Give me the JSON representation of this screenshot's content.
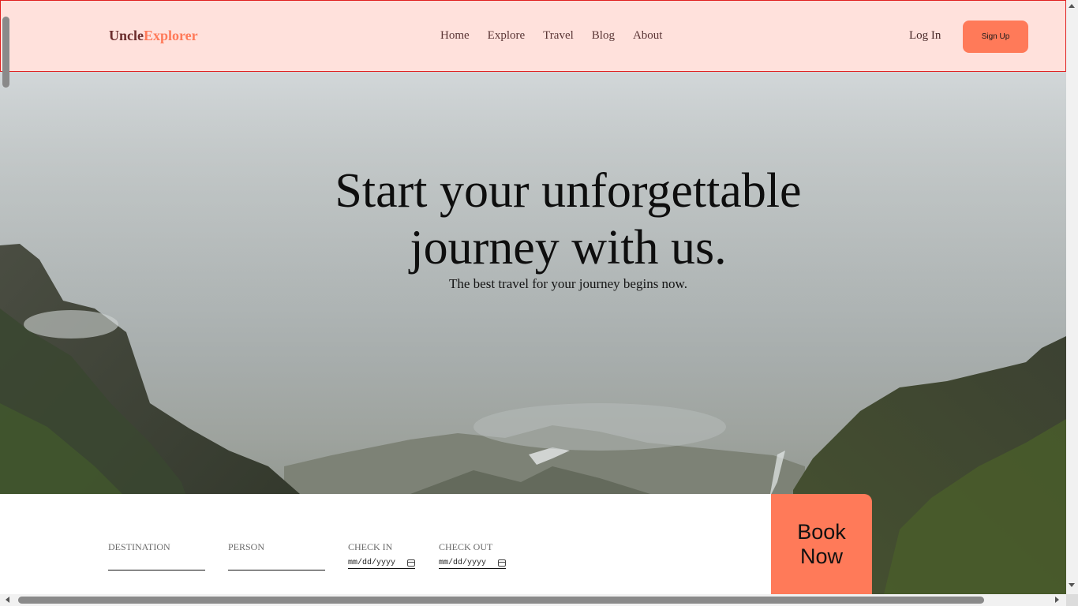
{
  "header": {
    "logo_part1": "Uncle",
    "logo_part2": "Explorer",
    "nav": [
      "Home",
      "Explore",
      "Travel",
      "Blog",
      "About"
    ],
    "login_label": "Log In",
    "signup_label": "Sign Up"
  },
  "hero": {
    "title": "Start your unforgettable journey with us.",
    "subtitle": "The best travel for your journey begins now."
  },
  "booking": {
    "destination_label": "DESTINATION",
    "person_label": "PERSON",
    "checkin_label": "CHECK IN",
    "checkout_label": "CHECK OUT",
    "date_placeholder": "mm/dd/yyyy",
    "book_label_line1": "Book",
    "book_label_line2": "Now"
  },
  "colors": {
    "accent": "#ff7a59",
    "header_bg": "#ffe1dc",
    "logo_dark": "#6b2d2d"
  }
}
